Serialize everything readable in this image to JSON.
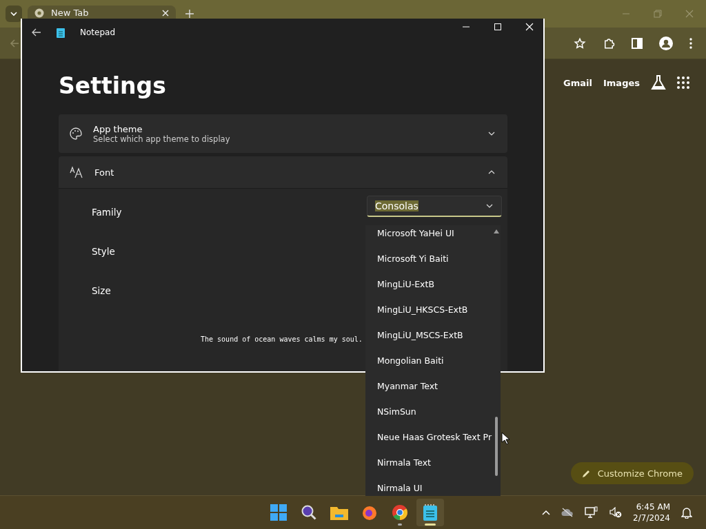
{
  "browser": {
    "tab": {
      "title": "New Tab"
    },
    "links": [
      "Gmail",
      "Images"
    ],
    "customize_button": "Customize Chrome"
  },
  "notepad": {
    "title": "Notepad",
    "heading": "Settings",
    "app_theme": {
      "title": "App theme",
      "description": "Select which app theme to display",
      "expanded": false
    },
    "font": {
      "title": "Font",
      "expanded": true,
      "rows": [
        "Family",
        "Style",
        "Size"
      ],
      "family_value": "Consolas",
      "preview": "The sound of ocean waves calms my soul."
    }
  },
  "font_list": [
    "Microsoft YaHei UI",
    "Microsoft Yi Baiti",
    "MingLiU-ExtB",
    "MingLiU_HKSCS-ExtB",
    "MingLiU_MSCS-ExtB",
    "Mongolian Baiti",
    "Myanmar Text",
    "NSimSun",
    "Neue Haas Grotesk Text Pr",
    "Nirmala Text",
    "Nirmala UI"
  ],
  "taskbar": {
    "apps": [
      {
        "kind": "start",
        "running": false,
        "active": false
      },
      {
        "kind": "search",
        "running": false,
        "active": false
      },
      {
        "kind": "files",
        "running": false,
        "active": false
      },
      {
        "kind": "firefox",
        "running": false,
        "active": false
      },
      {
        "kind": "chrome",
        "running": true,
        "active": false
      },
      {
        "kind": "notepad",
        "running": true,
        "active": true
      }
    ],
    "time": "6:45 AM",
    "date": "2/7/2024"
  }
}
